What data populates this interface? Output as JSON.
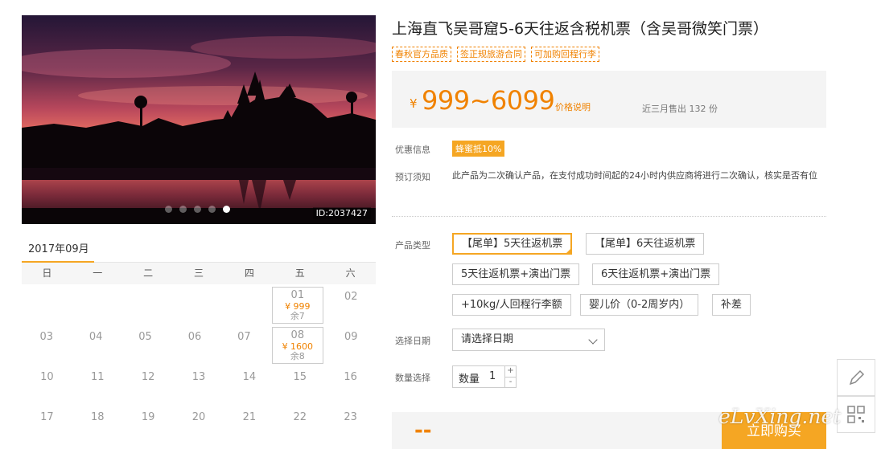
{
  "hero": {
    "id_label": "ID:2037427",
    "slides": 5,
    "active_slide": 4
  },
  "calendar": {
    "month": "2017年09月",
    "weekdays": [
      "日",
      "一",
      "二",
      "三",
      "四",
      "五",
      "六"
    ],
    "rows": [
      [
        {
          "d": ""
        },
        {
          "d": ""
        },
        {
          "d": ""
        },
        {
          "d": ""
        },
        {
          "d": ""
        },
        {
          "d": "01",
          "price": "¥ 999",
          "rest": "余7"
        },
        {
          "d": "02"
        }
      ],
      [
        {
          "d": "03"
        },
        {
          "d": "04"
        },
        {
          "d": "05"
        },
        {
          "d": "06"
        },
        {
          "d": "07"
        },
        {
          "d": "08",
          "price": "¥ 1600",
          "rest": "余8"
        },
        {
          "d": "09"
        }
      ],
      [
        {
          "d": "10"
        },
        {
          "d": "11"
        },
        {
          "d": "12"
        },
        {
          "d": "13"
        },
        {
          "d": "14"
        },
        {
          "d": "15"
        },
        {
          "d": "16"
        }
      ],
      [
        {
          "d": "17"
        },
        {
          "d": "18"
        },
        {
          "d": "19"
        },
        {
          "d": "20"
        },
        {
          "d": "21"
        },
        {
          "d": "22"
        },
        {
          "d": "23"
        }
      ]
    ]
  },
  "product": {
    "title": "上海直飞吴哥窟5-6天往返含税机票（含吴哥微笑门票）",
    "tags": [
      "春秋官方品质",
      "签正规旅游合同",
      "可加购回程行李"
    ],
    "price_symbol": "¥",
    "price_range": "999~6099",
    "price_note": "价格说明",
    "sold_text": "近三月售出 132 份"
  },
  "info": {
    "promo_label": "优惠信息",
    "promo_badge": "蜂蜜抵10%",
    "notice_label": "预订须知",
    "notice_text": "此产品为二次确认产品，在支付成功时间起的24小时内供应商将进行二次确认，核实是否有位"
  },
  "options": {
    "type_label": "产品类型",
    "types": [
      "【尾单】5天往返机票",
      "【尾单】6天往返机票",
      "5天往返机票+演出门票",
      "6天往返机票+演出门票",
      "+10kg/人回程行李额",
      "婴儿价（0-2周岁内）",
      "补差"
    ],
    "selected_type": 0,
    "date_label": "选择日期",
    "date_placeholder": "请选择日期",
    "qty_label": "数量选择",
    "qty_prefix": "数量",
    "qty_value": "1",
    "plus": "+",
    "minus": "-"
  },
  "footer": {
    "price_placeholder": "--",
    "buy_label": "立即购买",
    "watermark": "eLvXing.net"
  },
  "colors": {
    "accent": "#f5a623",
    "price": "#f08200"
  }
}
